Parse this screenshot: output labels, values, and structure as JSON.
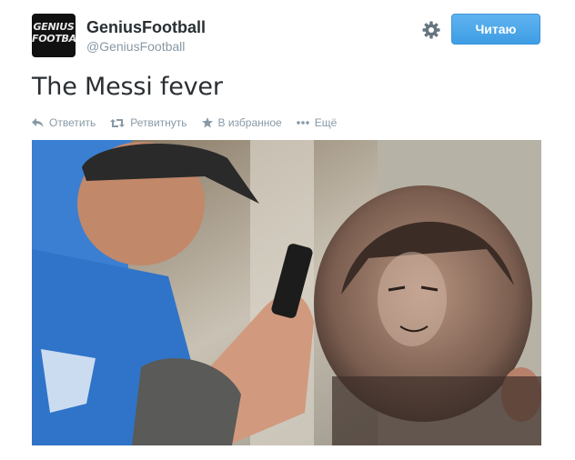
{
  "account": {
    "avatar_text": "GENIUS\nFOOTBALL",
    "name": "GeniusFootball",
    "handle": "@GeniusFootball"
  },
  "follow_button": {
    "label": "Читаю"
  },
  "tweet": {
    "text": "The Messi fever"
  },
  "actions": [
    {
      "label": "Ответить",
      "icon": "reply-icon"
    },
    {
      "label": "Ретвитнуть",
      "icon": "retweet-icon"
    },
    {
      "label": "В избранное",
      "icon": "star-icon"
    },
    {
      "label": "Ещё",
      "icon": "more-icon"
    }
  ],
  "photo": {
    "alt_name": "barber-hair-art-photo"
  }
}
